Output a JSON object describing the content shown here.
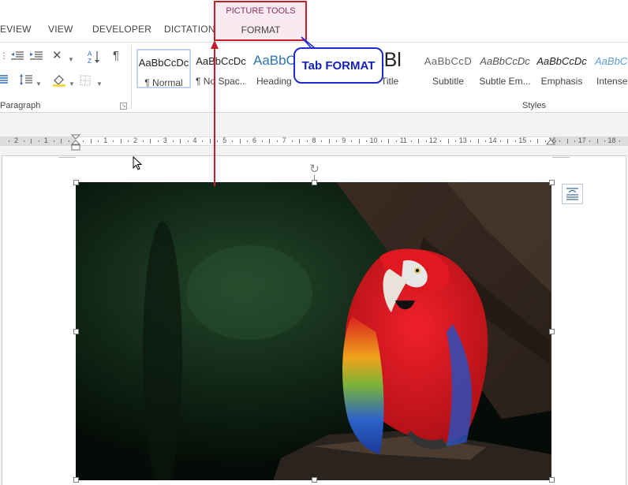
{
  "tabs": {
    "review": "EVIEW",
    "view": "VIEW",
    "developer": "DEVELOPER",
    "dictation": "DICTATION",
    "picture_tools_group": "PICTURE TOOLS",
    "format": "FORMAT"
  },
  "ribbon": {
    "paragraph_group_label": "Paragraph",
    "styles_group_label": "Styles",
    "styles": [
      {
        "preview": "AaBbCcDc",
        "name": "¶ Normal"
      },
      {
        "preview": "AaBbCcDc",
        "name": "¶ No Spac..."
      },
      {
        "preview": "AaBbC",
        "name": "Heading"
      },
      {
        "preview": "AaBl",
        "name": "Title"
      },
      {
        "preview": "AaBbCcD",
        "name": "Subtitle"
      },
      {
        "preview": "AaBbCcDc",
        "name": "Subtle Em..."
      },
      {
        "preview": "AaBbCcDc",
        "name": "Emphasis"
      },
      {
        "preview": "AaBbCcDc",
        "name": "Intense"
      }
    ],
    "icons": [
      "decrease-indent-icon",
      "increase-indent-icon",
      "text-direction-icon",
      "sort-icon",
      "pilcrow-icon",
      "justify-icon",
      "line-spacing-icon",
      "shading-icon",
      "borders-icon"
    ]
  },
  "ruler": {
    "labels": [
      "2",
      "1",
      "1",
      "2",
      "3",
      "4",
      "5",
      "6",
      "7",
      "8",
      "9",
      "10",
      "11",
      "12",
      "13",
      "14",
      "15",
      "16",
      "17",
      "18"
    ]
  },
  "callout": {
    "text": "Tab FORMAT"
  },
  "colors": {
    "annotation_red": "#c0202a",
    "callout_blue": "#1f2bd0",
    "context_tab_pink": "#f9eaf1",
    "context_title": "#8b2f61"
  },
  "document": {
    "image_alt": "scarlet-macaw-photo"
  }
}
